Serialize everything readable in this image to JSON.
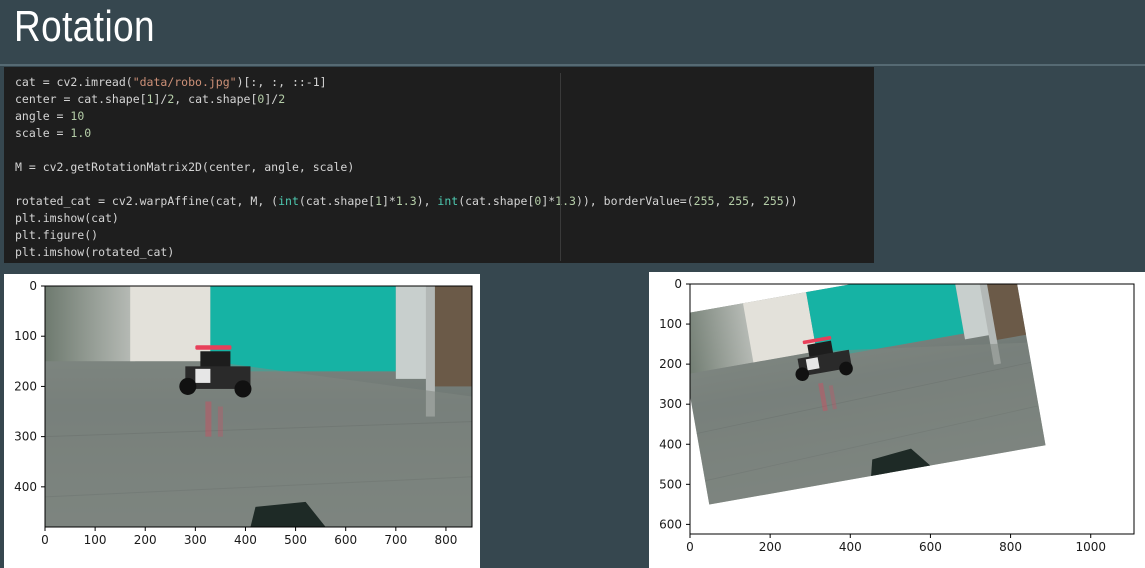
{
  "title": "Rotation",
  "code": {
    "lines": [
      [
        [
          "plain",
          "cat = cv2.imread("
        ],
        [
          "str",
          "\"data/robo.jpg\""
        ],
        [
          "plain",
          ")[:, :, ::-1]"
        ]
      ],
      [
        [
          "plain",
          "center = cat.shape["
        ],
        [
          "num",
          "1"
        ],
        [
          "plain",
          "]/"
        ],
        [
          "num",
          "2"
        ],
        [
          "plain",
          ", cat.shape["
        ],
        [
          "num",
          "0"
        ],
        [
          "plain",
          "]/"
        ],
        [
          "num",
          "2"
        ]
      ],
      [
        [
          "plain",
          "angle = "
        ],
        [
          "num",
          "10"
        ]
      ],
      [
        [
          "plain",
          "scale = "
        ],
        [
          "num",
          "1.0"
        ]
      ],
      [
        [
          "plain",
          ""
        ]
      ],
      [
        [
          "plain",
          "M = cv2.getRotationMatrix2D(center, angle, scale)"
        ]
      ],
      [
        [
          "plain",
          ""
        ]
      ],
      [
        [
          "plain",
          "rotated_cat = cv2.warpAffine(cat, M, ("
        ],
        [
          "builtin",
          "int"
        ],
        [
          "plain",
          "(cat.shape["
        ],
        [
          "num",
          "1"
        ],
        [
          "plain",
          "]*"
        ],
        [
          "num",
          "1.3"
        ],
        [
          "plain",
          "), "
        ],
        [
          "builtin",
          "int"
        ],
        [
          "plain",
          "(cat.shape["
        ],
        [
          "num",
          "0"
        ],
        [
          "plain",
          "]*"
        ],
        [
          "num",
          "1.3"
        ],
        [
          "plain",
          ")), borderValue=("
        ],
        [
          "num",
          "255"
        ],
        [
          "plain",
          ", "
        ],
        [
          "num",
          "255"
        ],
        [
          "plain",
          ", "
        ],
        [
          "num",
          "255"
        ],
        [
          "plain",
          "))"
        ]
      ],
      [
        [
          "plain",
          "plt.imshow(cat)"
        ]
      ],
      [
        [
          "plain",
          "plt.figure()"
        ]
      ],
      [
        [
          "plain",
          "plt.imshow(rotated_cat)"
        ]
      ]
    ]
  },
  "plot_original": {
    "x_ticks": [
      "0",
      "100",
      "200",
      "300",
      "400",
      "500",
      "600",
      "700",
      "800"
    ],
    "x_values": [
      0,
      100,
      200,
      300,
      400,
      500,
      600,
      700,
      800
    ],
    "x_max": 852,
    "y_ticks": [
      "0",
      "100",
      "200",
      "300",
      "400"
    ],
    "y_values": [
      0,
      100,
      200,
      300,
      400
    ],
    "y_max": 480
  },
  "plot_rotated": {
    "x_ticks": [
      "0",
      "200",
      "400",
      "600",
      "800",
      "1000"
    ],
    "x_values": [
      0,
      200,
      400,
      600,
      800,
      1000
    ],
    "x_max": 1108,
    "y_ticks": [
      "0",
      "100",
      "200",
      "300",
      "400",
      "500",
      "600"
    ],
    "y_values": [
      0,
      100,
      200,
      300,
      400,
      500,
      600
    ],
    "y_max": 624,
    "rotation_deg": 10
  },
  "colors": {
    "background": "#36474f",
    "code_bg": "#1e1e1e",
    "teal_wall": "#15b5a6",
    "floor": "#7d8580",
    "robot_marker": "#e8405a"
  }
}
